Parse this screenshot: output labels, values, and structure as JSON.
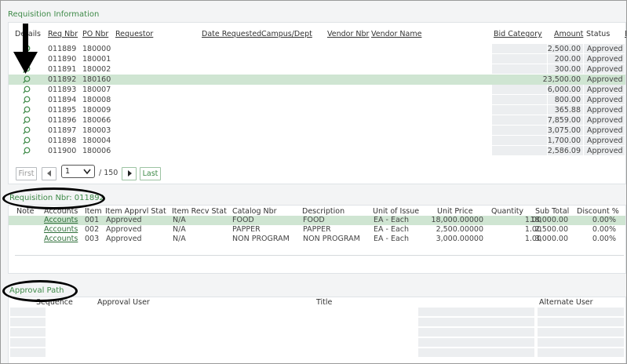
{
  "requisition_info": {
    "title": "Requisition Information",
    "headers": {
      "details": "Details",
      "req_nbr": "Req Nbr",
      "po_nbr": "PO Nbr",
      "requestor": "Requestor",
      "date_requested": "Date Requested",
      "campus_dept": "Campus/Dept",
      "vendor_nbr": "Vendor Nbr",
      "vendor_name": "Vendor Name",
      "bid_category": "Bid Category",
      "amount": "Amount",
      "status": "Status"
    },
    "rows": [
      {
        "req": "011889",
        "po": "180000",
        "amount": "2,500.00",
        "status": "Approved",
        "selected": false
      },
      {
        "req": "011890",
        "po": "180001",
        "amount": "200.00",
        "status": "Approved",
        "selected": false
      },
      {
        "req": "011891",
        "po": "180002",
        "amount": "300.00",
        "status": "Approved",
        "selected": false
      },
      {
        "req": "011892",
        "po": "180160",
        "amount": "23,500.00",
        "status": "Approved",
        "selected": true
      },
      {
        "req": "011893",
        "po": "180007",
        "amount": "6,000.00",
        "status": "Approved",
        "selected": false
      },
      {
        "req": "011894",
        "po": "180008",
        "amount": "800.00",
        "status": "Approved",
        "selected": false
      },
      {
        "req": "011895",
        "po": "180009",
        "amount": "365.88",
        "status": "Approved",
        "selected": false
      },
      {
        "req": "011896",
        "po": "180066",
        "amount": "7,859.00",
        "status": "Approved",
        "selected": false
      },
      {
        "req": "011897",
        "po": "180003",
        "amount": "3,075.00",
        "status": "Approved",
        "selected": false
      },
      {
        "req": "011898",
        "po": "180004",
        "amount": "1,700.00",
        "status": "Approved",
        "selected": false
      },
      {
        "req": "011900",
        "po": "180006",
        "amount": "2,586.09",
        "status": "Approved",
        "selected": false
      }
    ],
    "pager": {
      "first": "First",
      "prev_icon": "chevron-left-icon",
      "page": "1",
      "of_pages": "/ 150",
      "next_icon": "chevron-right-icon",
      "last": "Last"
    }
  },
  "requisition_detail": {
    "title": "Requisition Nbr:  011892",
    "headers": {
      "note": "Note",
      "accounts": "Accounts",
      "item": "Item",
      "item_apprvl_stat": "Item Apprvl Stat",
      "item_recv_stat": "Item Recv Stat",
      "catalog_nbr": "Catalog Nbr",
      "description": "Description",
      "unit_of_issue": "Unit of Issue",
      "unit_price": "Unit Price",
      "quantity": "Quantity",
      "sub_total": "Sub Total",
      "discount_pct": "Discount %"
    },
    "rows": [
      {
        "accounts": "Accounts",
        "item": "001",
        "apprvl": "Approved",
        "recv": "N/A",
        "catalog": "FOOD",
        "description": "FOOD",
        "unit": "EA - Each",
        "unit_price": "18,000.00000",
        "qty": "1.00",
        "sub_total": "18,000.00",
        "discount": "0.00%",
        "selected": true
      },
      {
        "accounts": "Accounts",
        "item": "002",
        "apprvl": "Approved",
        "recv": "N/A",
        "catalog": "PAPPER",
        "description": "PAPPER",
        "unit": "EA - Each",
        "unit_price": "2,500.00000",
        "qty": "1.00",
        "sub_total": "2,500.00",
        "discount": "0.00%",
        "selected": false
      },
      {
        "accounts": "Accounts",
        "item": "003",
        "apprvl": "Approved",
        "recv": "N/A",
        "catalog": "NON PROGRAM",
        "description": "NON PROGRAM",
        "unit": "EA - Each",
        "unit_price": "3,000.00000",
        "qty": "1.00",
        "sub_total": "3,000.00",
        "discount": "0.00%",
        "selected": false
      }
    ]
  },
  "approval_path": {
    "title": "Approval Path",
    "headers": {
      "sequence": "Sequence",
      "approval_user": "Approval User",
      "title": "Title",
      "alternate_user": "Alternate User"
    }
  },
  "colors": {
    "accent_green": "#3e8a48",
    "selected_row": "#cfe5d2",
    "annotation": "#000000"
  }
}
